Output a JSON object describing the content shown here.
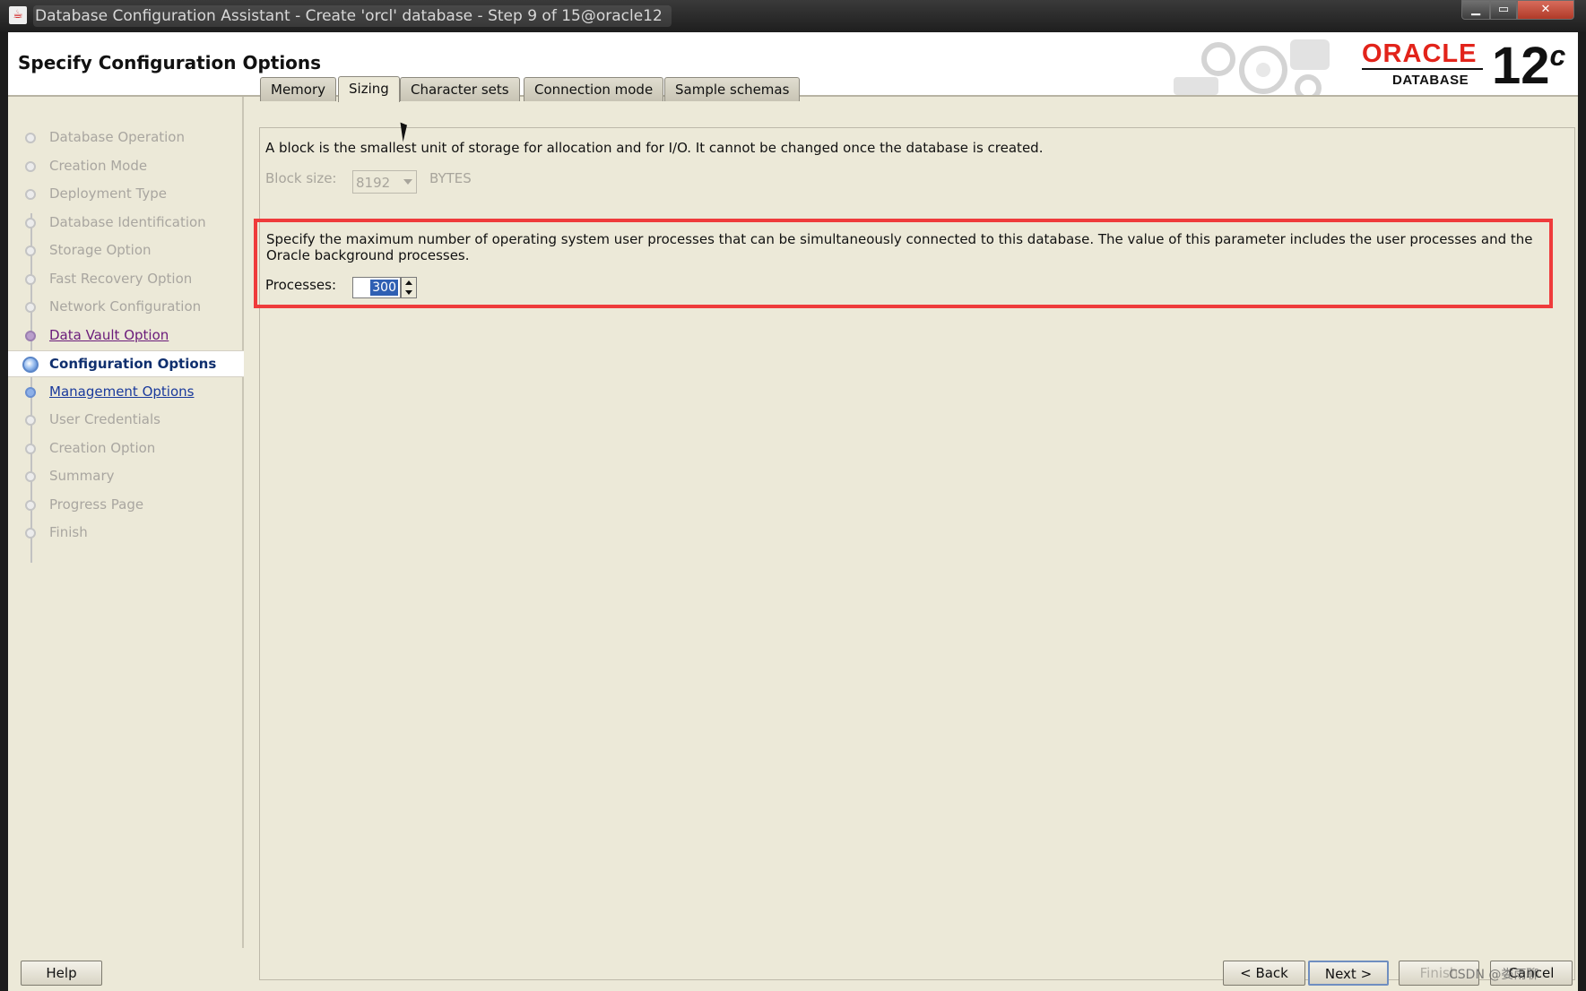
{
  "window": {
    "title": "Database Configuration Assistant - Create 'orcl' database - Step 9 of 15@oracle12",
    "controls": [
      "minimize",
      "maximize",
      "close"
    ]
  },
  "header": {
    "title": "Specify Configuration Options",
    "brand": "ORACLE",
    "brand_sub": "DATABASE",
    "version": "12",
    "version_suffix": "c"
  },
  "steps": [
    {
      "label": "Database Operation",
      "state": "disabled"
    },
    {
      "label": "Creation Mode",
      "state": "disabled"
    },
    {
      "label": "Deployment Type",
      "state": "disabled"
    },
    {
      "label": "Database Identification",
      "state": "disabled"
    },
    {
      "label": "Storage Option",
      "state": "disabled"
    },
    {
      "label": "Fast Recovery Option",
      "state": "disabled"
    },
    {
      "label": "Network Configuration",
      "state": "disabled"
    },
    {
      "label": "Data Vault Option",
      "state": "visited"
    },
    {
      "label": "Configuration Options",
      "state": "active"
    },
    {
      "label": "Management Options",
      "state": "link"
    },
    {
      "label": "User Credentials",
      "state": "disabled"
    },
    {
      "label": "Creation Option",
      "state": "disabled"
    },
    {
      "label": "Summary",
      "state": "disabled"
    },
    {
      "label": "Progress Page",
      "state": "disabled"
    },
    {
      "label": "Finish",
      "state": "disabled"
    }
  ],
  "tabs": [
    "Memory",
    "Sizing",
    "Character sets",
    "Connection mode",
    "Sample schemas"
  ],
  "active_tab": "Sizing",
  "sizing": {
    "block_desc": "A block is the smallest unit of storage for allocation and for I/O. It cannot be changed once the database is created.",
    "block_label": "Block size:",
    "block_value": "8192",
    "block_unit": "BYTES",
    "process_desc": "Specify the maximum number of operating system user processes that can be simultaneously connected to this database. The value of this parameter includes the user processes and the Oracle background processes.",
    "process_label": "Processes:",
    "process_value": "300"
  },
  "buttons": {
    "help": "Help",
    "back": "< Back",
    "next": "Next >",
    "finish": "Finish",
    "cancel": "Cancel"
  },
  "watermark": "CSDN @娄雨聊"
}
